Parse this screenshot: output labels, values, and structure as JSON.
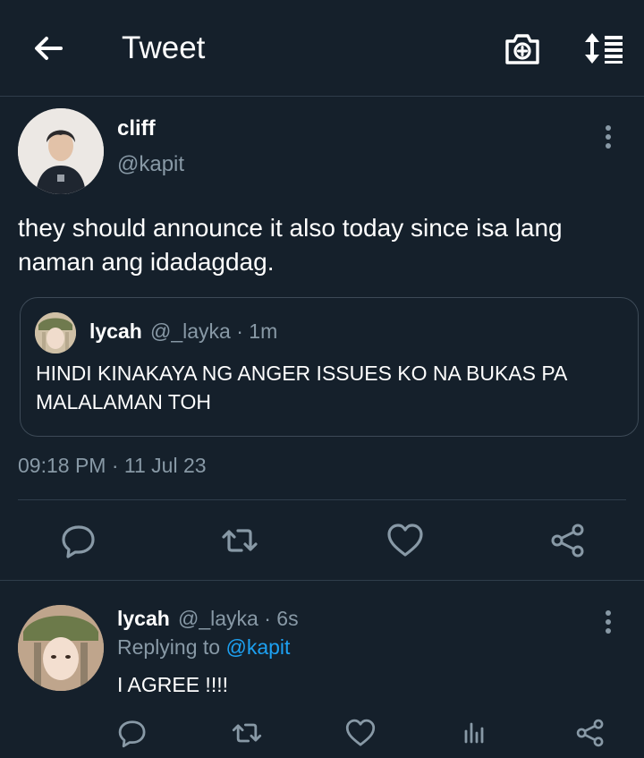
{
  "header": {
    "title": "Tweet",
    "icons": {
      "back": "arrow-left-icon",
      "camera": "camera-add-icon",
      "sort": "sort-icon"
    }
  },
  "tweet": {
    "author_name": "cliff",
    "author_handle": "@kapit",
    "text": "they should announce it also today since isa lang naman ang idadagdag.",
    "quoted": {
      "author_name": "lycah",
      "author_handle": "@_layka",
      "separator": "·",
      "time": "1m",
      "text": "HINDI KINAKAYA NG ANGER ISSUES KO NA BUKAS PA MALALAMAN TOH"
    },
    "timestamp": "09:18 PM · 11 Jul 23",
    "actions": [
      "reply-icon",
      "retweet-icon",
      "like-icon",
      "share-icon"
    ]
  },
  "reply": {
    "author_name": "lycah",
    "author_handle": "@_layka",
    "separator": "·",
    "time": "6s",
    "replying_to_label": "Replying to",
    "replying_to_handle": "@kapit",
    "text": "I AGREE !!!!",
    "actions": [
      "reply-icon",
      "retweet-icon",
      "like-icon",
      "analytics-icon",
      "share-icon"
    ]
  },
  "colors": {
    "background": "#15202b",
    "muted_text": "#8899a6",
    "link": "#1da1f2",
    "divider": "#2f3d4b"
  }
}
